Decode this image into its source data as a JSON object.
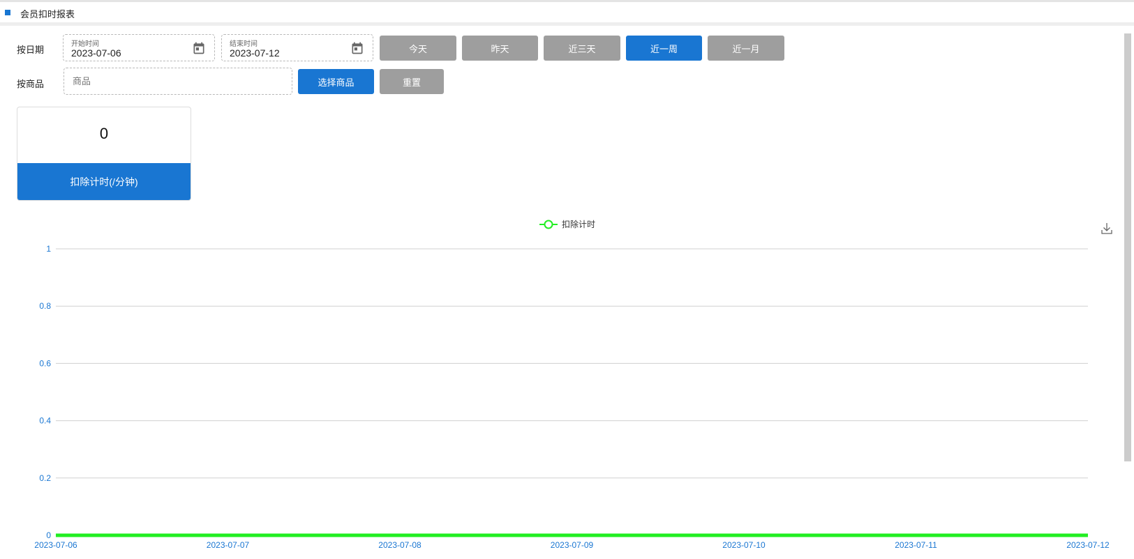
{
  "header": {
    "title": "会员扣时报表"
  },
  "filters": {
    "date_label": "按日期",
    "start": {
      "label": "开始时间",
      "value": "2023-07-06"
    },
    "end": {
      "label": "结束时间",
      "value": "2023-07-12"
    },
    "quick_ranges": [
      "今天",
      "昨天",
      "近三天",
      "近一周",
      "近一月"
    ],
    "selected_range": "近一周",
    "goods_label": "按商品",
    "goods_placeholder": "商品",
    "select_goods_label": "选择商品",
    "reset_label": "重置"
  },
  "stat": {
    "value": "0",
    "label": "扣除计时(/分钟)"
  },
  "colors": {
    "primary": "#1976d2",
    "series": "#22ee22",
    "gray_button": "#9e9e9e"
  },
  "icons": {
    "calendar": "calendar-icon",
    "download": "download-icon"
  },
  "chart_data": {
    "type": "line",
    "categories": [
      "2023-07-06",
      "2023-07-07",
      "2023-07-08",
      "2023-07-09",
      "2023-07-10",
      "2023-07-11",
      "2023-07-12"
    ],
    "series": [
      {
        "name": "扣除计时",
        "values": [
          0,
          0,
          0,
          0,
          0,
          0,
          0
        ],
        "color": "#22ee22"
      }
    ],
    "ylim": [
      0,
      1
    ],
    "yticks": [
      0,
      0.2,
      0.4,
      0.6,
      0.8,
      1
    ],
    "ytick_labels": [
      "0",
      "0.2",
      "0.4",
      "0.6",
      "0.8",
      "1"
    ],
    "grid": true,
    "legend": "top-center"
  }
}
